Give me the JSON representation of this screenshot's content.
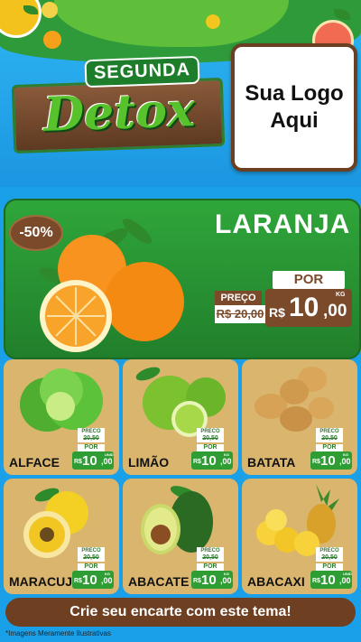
{
  "header": {
    "subtitle": "SEGUNDA",
    "title": "Detox",
    "logo_placeholder": "Sua Logo Aqui"
  },
  "featured": {
    "discount": "-50%",
    "product": "LARANJA",
    "por_label": "POR",
    "preco_label": "PREÇO",
    "old_price": "R$ 20,00",
    "currency": "R$",
    "price_int": "10",
    "price_dec": ",00",
    "unit": "KG"
  },
  "products": [
    {
      "name": "ALFACE",
      "preco_label": "PRECO",
      "old_price": "20,50",
      "por_label": "POR",
      "currency": "R$",
      "price_int": "10",
      "price_dec": ",00",
      "unit": "UNID"
    },
    {
      "name": "LIMÃO",
      "preco_label": "PRECO",
      "old_price": "20,50",
      "por_label": "POR",
      "currency": "R$",
      "price_int": "10",
      "price_dec": ",00",
      "unit": "KG"
    },
    {
      "name": "BATATA",
      "preco_label": "PRECO",
      "old_price": "20,50",
      "por_label": "POR",
      "currency": "R$",
      "price_int": "10",
      "price_dec": ",00",
      "unit": "KG"
    },
    {
      "name": "MARACUJÁ",
      "preco_label": "PRECO",
      "old_price": "20,50",
      "por_label": "POR",
      "currency": "R$",
      "price_int": "10",
      "price_dec": ",00",
      "unit": "KG"
    },
    {
      "name": "ABACATE",
      "preco_label": "PRECO",
      "old_price": "20,50",
      "por_label": "POR",
      "currency": "R$",
      "price_int": "10",
      "price_dec": ",00",
      "unit": "KG"
    },
    {
      "name": "ABACAXI",
      "preco_label": "PRECO",
      "old_price": "20,50",
      "por_label": "POR",
      "currency": "R$",
      "price_int": "10",
      "price_dec": ",00",
      "unit": "UNID"
    }
  ],
  "cta": "Crie seu encarte com este tema!",
  "footnote": "*Imagens Meramente Ilustrativas",
  "colors": {
    "brand_green": "#2fa63a",
    "wood_brown": "#7a4a2b",
    "card_tan": "#d9b56e",
    "sky_blue": "#1aa0e8"
  }
}
